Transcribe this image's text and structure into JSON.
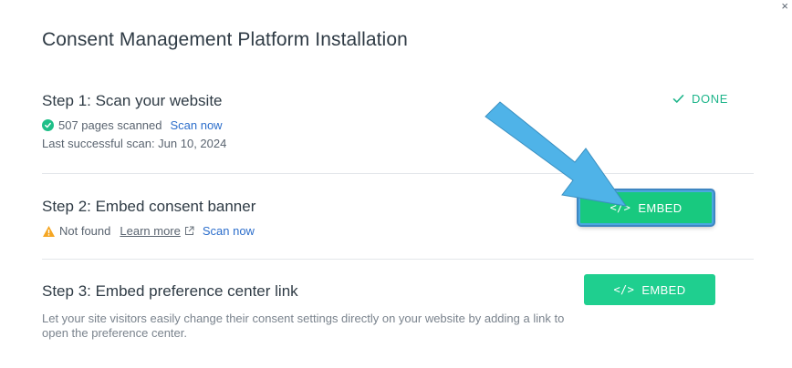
{
  "dialog": {
    "title": "Consent Management Platform Installation",
    "close_glyph": "×"
  },
  "step1": {
    "title": "Step 1: Scan your website",
    "pages_scanned": "507 pages scanned",
    "scan_now": "Scan now",
    "last_scan": "Last successful scan: Jun 10, 2024",
    "status": "DONE",
    "status_icon": "check-icon"
  },
  "step2": {
    "title": "Step 2: Embed consent banner",
    "status_text": "Not found",
    "learn_more": "Learn more",
    "scan_now": "Scan now",
    "button": "EMBED",
    "status_icon": "warning-icon"
  },
  "step3": {
    "title": "Step 3: Embed preference center link",
    "description": "Let your site visitors easily change their consent settings directly on your website by adding a link to open the preference center.",
    "button": "EMBED"
  },
  "colors": {
    "accent_green": "#1fcf8f",
    "done_green": "#1fb58b",
    "link_blue": "#2c6ecb",
    "warning_orange": "#f5a623",
    "annotation_arrow": "#4fb3e8"
  }
}
